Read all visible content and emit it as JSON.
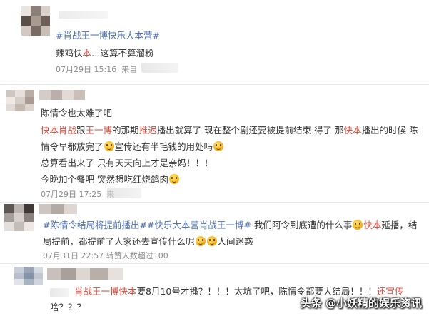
{
  "comments": [
    {
      "tag": "#肖战王一博快乐大本营#",
      "lines": [
        [
          "辣鸡快",
          "本",
          "…这算不算溜粉"
        ]
      ],
      "time": "07月29日 15:16",
      "source": "来自"
    },
    {
      "line1": "陈情令也太难了吧",
      "line2_parts": [
        "快本肖战",
        "跟",
        "王一博",
        "的那期",
        "推迟",
        "播出就算了 现在整个剧还要被提前结束 得了 那",
        "快本",
        "播出的时候 陈"
      ],
      "line3_a": "情令早都放完了",
      "line3_b": "宣传还有半毛钱的用处吗",
      "line4": "总算看出来了 只有天天向上才是亲妈！！！",
      "line5": "今晚加个餐吧 突然想吃红烧鸽肉",
      "time": "07月29日 17:25",
      "source": "来"
    },
    {
      "tags": "#陈情令结局将提前播出##快乐大本营肖战王一博#",
      "text_a": " 我们阿令到底遭的什么事",
      "red_a": "快本",
      "text_b": "延播，结",
      "line2_a": "局提前，都提前了人家还去宣传什么呢",
      "line2_b": "人间迷惑",
      "time": "07月31日 22:57",
      "likes": "转赞人数超过100"
    },
    {
      "red_a": "肖战王一博快本",
      "text_a": "要8月10号才播？！！！太坑了吧，陈情令都要大结局！！！",
      "red_b": "还宣传",
      "line2": "啥？？？"
    }
  ],
  "watermark": "头条 @小妖精的娱乐资讯",
  "colors": {
    "link_blue": "#4d6fb5",
    "highlight_red": "#e0473a",
    "meta_gray": "#8a8a8a"
  },
  "icons": [
    "smile-emoji-icon",
    "think-emoji-icon"
  ]
}
